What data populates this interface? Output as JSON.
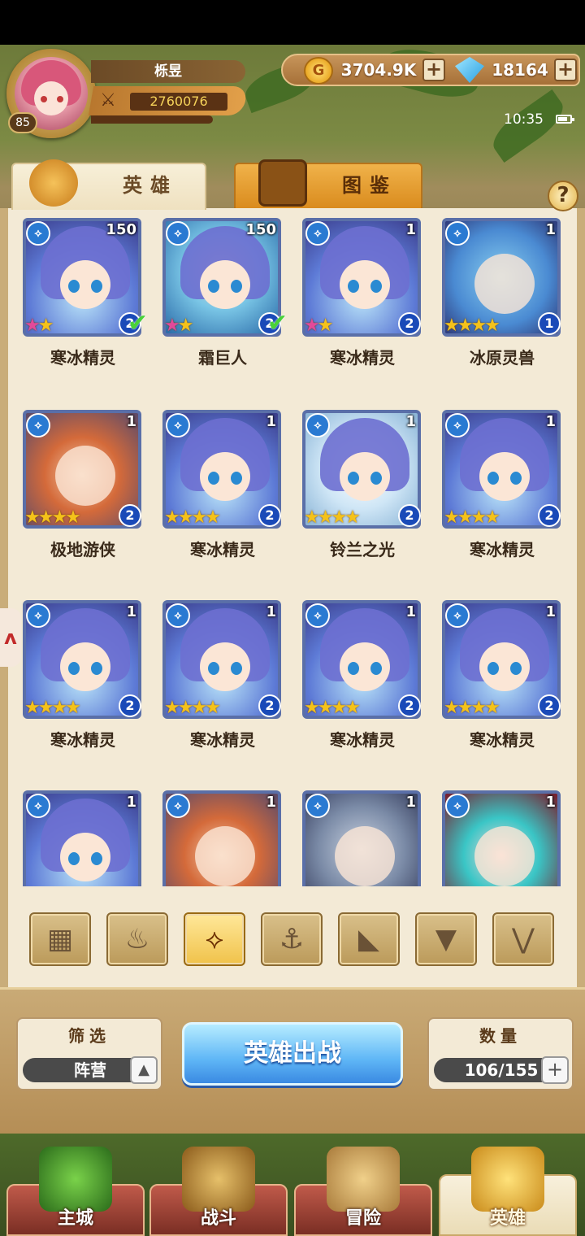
{
  "player": {
    "name": "栎昱",
    "level": "85",
    "power": "2760076"
  },
  "resources": {
    "gold": "3704.9K",
    "gold_icon": "G",
    "gems": "18164",
    "plus": "+"
  },
  "status": {
    "time": "10:35"
  },
  "tabs": {
    "heroes": "英雄",
    "encyclopedia": "图鉴",
    "help": "?"
  },
  "heroes": [
    {
      "name": "寒冰精灵",
      "level": "150",
      "stars": "★★",
      "rainbow": true,
      "rank": "2",
      "check": true,
      "art": "ice"
    },
    {
      "name": "霜巨人",
      "level": "150",
      "stars": "★★",
      "rainbow": true,
      "rank": "2",
      "check": true,
      "art": "frost"
    },
    {
      "name": "寒冰精灵",
      "level": "1",
      "stars": "★★",
      "rainbow": true,
      "rank": "2",
      "check": false,
      "art": "ice"
    },
    {
      "name": "冰原灵兽",
      "level": "1",
      "stars": "★★★★",
      "rainbow": false,
      "rank": "1",
      "check": false,
      "art": "beast"
    },
    {
      "name": "极地游侠",
      "level": "1",
      "stars": "★★★★",
      "rainbow": false,
      "rank": "2",
      "check": false,
      "art": "ranger"
    },
    {
      "name": "寒冰精灵",
      "level": "1",
      "stars": "★★★★",
      "rainbow": false,
      "rank": "2",
      "check": false,
      "art": "ice"
    },
    {
      "name": "铃兰之光",
      "level": "1",
      "stars": "★★★★",
      "rainbow": false,
      "rank": "2",
      "check": false,
      "art": "light"
    },
    {
      "name": "寒冰精灵",
      "level": "1",
      "stars": "★★★★",
      "rainbow": false,
      "rank": "2",
      "check": false,
      "art": "ice"
    },
    {
      "name": "寒冰精灵",
      "level": "1",
      "stars": "★★★★",
      "rainbow": false,
      "rank": "2",
      "check": false,
      "art": "ice"
    },
    {
      "name": "寒冰精灵",
      "level": "1",
      "stars": "★★★★",
      "rainbow": false,
      "rank": "2",
      "check": false,
      "art": "ice"
    },
    {
      "name": "寒冰精灵",
      "level": "1",
      "stars": "★★★★",
      "rainbow": false,
      "rank": "2",
      "check": false,
      "art": "ice"
    },
    {
      "name": "寒冰精灵",
      "level": "1",
      "stars": "★★★★",
      "rainbow": false,
      "rank": "2",
      "check": false,
      "art": "ice"
    },
    {
      "name": "",
      "level": "1",
      "stars": "",
      "rainbow": false,
      "rank": "",
      "check": false,
      "art": "ice"
    },
    {
      "name": "",
      "level": "1",
      "stars": "",
      "rainbow": false,
      "rank": "",
      "check": false,
      "art": "ranger"
    },
    {
      "name": "",
      "level": "1",
      "stars": "",
      "rainbow": false,
      "rank": "",
      "check": false,
      "art": "knight"
    },
    {
      "name": "",
      "level": "1",
      "stars": "",
      "rainbow": false,
      "rank": "",
      "check": false,
      "art": "demon"
    }
  ],
  "faction_filters": [
    {
      "icon": "grid-icon",
      "glyph": "▦",
      "active": false
    },
    {
      "icon": "flame-crest-icon",
      "glyph": "♨",
      "active": false
    },
    {
      "icon": "ice-crest-icon",
      "glyph": "⟡",
      "active": true
    },
    {
      "icon": "anchor-icon",
      "glyph": "⚓",
      "active": false
    },
    {
      "icon": "beast-head-icon",
      "glyph": "◣",
      "active": false
    },
    {
      "icon": "dark-wing-icon",
      "glyph": "▼",
      "active": false
    },
    {
      "icon": "horn-icon",
      "glyph": "⋁",
      "active": false
    }
  ],
  "controls": {
    "filter_title": "筛选",
    "filter_value": "阵营",
    "deploy": "英雄出战",
    "count_title": "数量",
    "count_value": "106/155"
  },
  "nav": [
    {
      "label": "主城",
      "icon": "castle-icon",
      "active": false
    },
    {
      "label": "战斗",
      "icon": "crossed-swords-icon",
      "active": false
    },
    {
      "label": "冒险",
      "icon": "scroll-map-icon",
      "active": false
    },
    {
      "label": "英雄",
      "icon": "hero-crest-icon",
      "active": true
    }
  ],
  "colors": {
    "accent": "#f0b24a",
    "panel": "#f3ead6",
    "deploy": "#5fb6f6",
    "star": "#f4c21a"
  }
}
